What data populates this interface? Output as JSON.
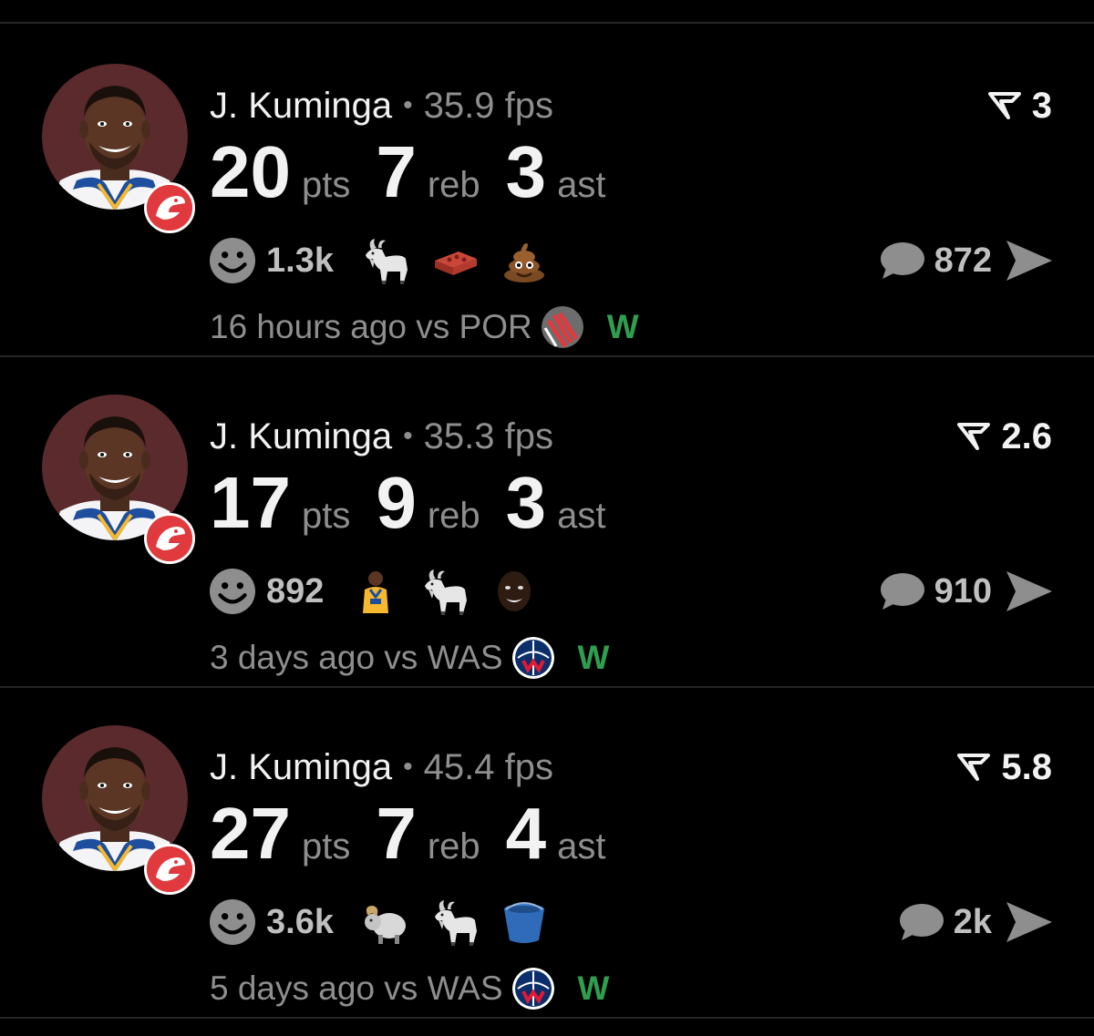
{
  "posts": [
    {
      "player": "J. Kuminga",
      "fps": "35.9 fps",
      "rating": "3",
      "stats": [
        {
          "value": "20",
          "unit": "pts"
        },
        {
          "value": "7",
          "unit": "reb"
        },
        {
          "value": "3",
          "unit": "ast"
        }
      ],
      "reaction_count": "1.3k",
      "reactions": [
        "goat-emoji",
        "brick-emoji",
        "poop-emoji"
      ],
      "comments": "872",
      "meta_text": "16 hours ago vs POR",
      "opponent_logo": "blazers-logo-icon",
      "result": "W"
    },
    {
      "player": "J. Kuminga",
      "fps": "35.3 fps",
      "rating": "2.6",
      "stats": [
        {
          "value": "17",
          "unit": "pts"
        },
        {
          "value": "9",
          "unit": "reb"
        },
        {
          "value": "3",
          "unit": "ast"
        }
      ],
      "reaction_count": "892",
      "reactions": [
        "player-sticker",
        "goat-emoji",
        "player-face-sticker"
      ],
      "comments": "910",
      "meta_text": "3 days ago vs WAS",
      "opponent_logo": "wizards-logo-icon",
      "result": "W"
    },
    {
      "player": "J. Kuminga",
      "fps": "45.4 fps",
      "rating": "5.8",
      "stats": [
        {
          "value": "27",
          "unit": "pts"
        },
        {
          "value": "7",
          "unit": "reb"
        },
        {
          "value": "4",
          "unit": "ast"
        }
      ],
      "reaction_count": "3.6k",
      "reactions": [
        "ram-emoji",
        "goat-emoji",
        "bucket-emoji"
      ],
      "comments": "2k",
      "meta_text": "5 days ago vs WAS",
      "opponent_logo": "wizards-logo-icon",
      "result": "W"
    }
  ],
  "colors": {
    "background": "#000000",
    "primary_text": "#f2f2f2",
    "secondary_text": "#8e8e8e",
    "win": "#2f9e4f",
    "avatar_bg": "#5a2a2c",
    "hawks_red": "#e03a3e"
  }
}
